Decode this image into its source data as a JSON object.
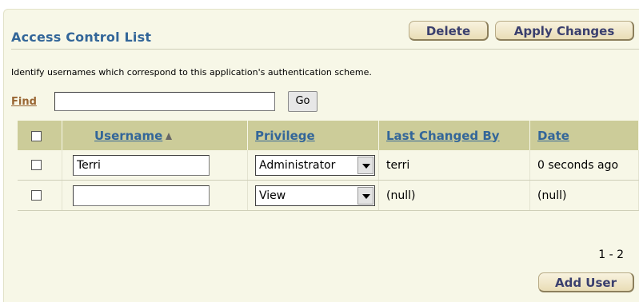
{
  "region": {
    "title": "Access Control List",
    "delete_label": "Delete",
    "apply_label": "Apply Changes",
    "description": "Identify usernames which correspond to this application's authentication scheme.",
    "find_label": "Find",
    "find_value": "",
    "go_label": "Go",
    "pagination": "1 - 2",
    "add_user_label": "Add User"
  },
  "table": {
    "headers": [
      "Username",
      "Privilege",
      "Last Changed By",
      "Date"
    ],
    "rows": [
      {
        "username": "Terri",
        "privilege": "Administrator",
        "last_changed_by": "terri",
        "date": "0 seconds ago"
      },
      {
        "username": "",
        "privilege": "View",
        "last_changed_by": "(null)",
        "date": "(null)"
      }
    ]
  },
  "colors": {
    "header_bg": "#cccc99",
    "region_bg": "#f7f7e7",
    "title": "#336699",
    "link": "#996633"
  },
  "icons": [
    "sort-ascending-icon",
    "dropdown-arrow-icon",
    "checkbox-icon"
  ]
}
